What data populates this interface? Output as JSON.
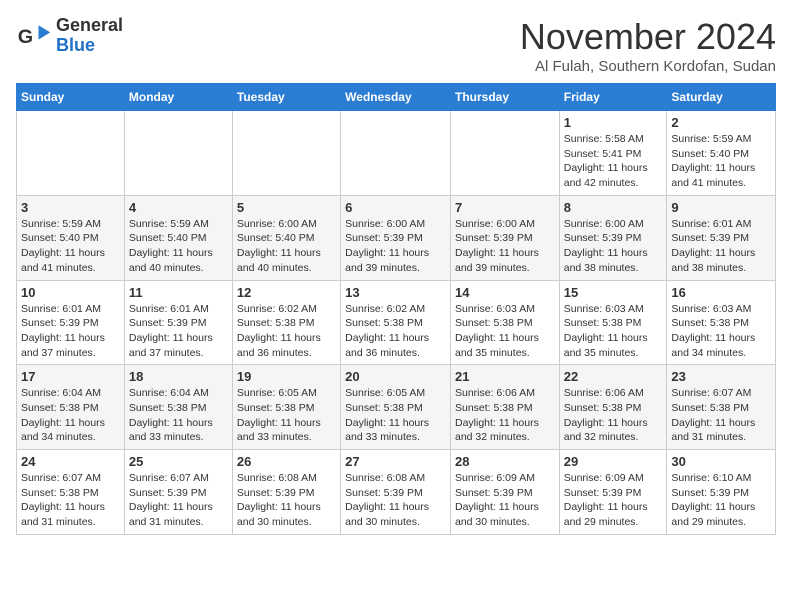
{
  "logo": {
    "text_general": "General",
    "text_blue": "Blue"
  },
  "title": "November 2024",
  "location": "Al Fulah, Southern Kordofan, Sudan",
  "days_of_week": [
    "Sunday",
    "Monday",
    "Tuesday",
    "Wednesday",
    "Thursday",
    "Friday",
    "Saturday"
  ],
  "weeks": [
    [
      {
        "day": "",
        "info": ""
      },
      {
        "day": "",
        "info": ""
      },
      {
        "day": "",
        "info": ""
      },
      {
        "day": "",
        "info": ""
      },
      {
        "day": "",
        "info": ""
      },
      {
        "day": "1",
        "info": "Sunrise: 5:58 AM\nSunset: 5:41 PM\nDaylight: 11 hours\nand 42 minutes."
      },
      {
        "day": "2",
        "info": "Sunrise: 5:59 AM\nSunset: 5:40 PM\nDaylight: 11 hours\nand 41 minutes."
      }
    ],
    [
      {
        "day": "3",
        "info": "Sunrise: 5:59 AM\nSunset: 5:40 PM\nDaylight: 11 hours\nand 41 minutes."
      },
      {
        "day": "4",
        "info": "Sunrise: 5:59 AM\nSunset: 5:40 PM\nDaylight: 11 hours\nand 40 minutes."
      },
      {
        "day": "5",
        "info": "Sunrise: 6:00 AM\nSunset: 5:40 PM\nDaylight: 11 hours\nand 40 minutes."
      },
      {
        "day": "6",
        "info": "Sunrise: 6:00 AM\nSunset: 5:39 PM\nDaylight: 11 hours\nand 39 minutes."
      },
      {
        "day": "7",
        "info": "Sunrise: 6:00 AM\nSunset: 5:39 PM\nDaylight: 11 hours\nand 39 minutes."
      },
      {
        "day": "8",
        "info": "Sunrise: 6:00 AM\nSunset: 5:39 PM\nDaylight: 11 hours\nand 38 minutes."
      },
      {
        "day": "9",
        "info": "Sunrise: 6:01 AM\nSunset: 5:39 PM\nDaylight: 11 hours\nand 38 minutes."
      }
    ],
    [
      {
        "day": "10",
        "info": "Sunrise: 6:01 AM\nSunset: 5:39 PM\nDaylight: 11 hours\nand 37 minutes."
      },
      {
        "day": "11",
        "info": "Sunrise: 6:01 AM\nSunset: 5:39 PM\nDaylight: 11 hours\nand 37 minutes."
      },
      {
        "day": "12",
        "info": "Sunrise: 6:02 AM\nSunset: 5:38 PM\nDaylight: 11 hours\nand 36 minutes."
      },
      {
        "day": "13",
        "info": "Sunrise: 6:02 AM\nSunset: 5:38 PM\nDaylight: 11 hours\nand 36 minutes."
      },
      {
        "day": "14",
        "info": "Sunrise: 6:03 AM\nSunset: 5:38 PM\nDaylight: 11 hours\nand 35 minutes."
      },
      {
        "day": "15",
        "info": "Sunrise: 6:03 AM\nSunset: 5:38 PM\nDaylight: 11 hours\nand 35 minutes."
      },
      {
        "day": "16",
        "info": "Sunrise: 6:03 AM\nSunset: 5:38 PM\nDaylight: 11 hours\nand 34 minutes."
      }
    ],
    [
      {
        "day": "17",
        "info": "Sunrise: 6:04 AM\nSunset: 5:38 PM\nDaylight: 11 hours\nand 34 minutes."
      },
      {
        "day": "18",
        "info": "Sunrise: 6:04 AM\nSunset: 5:38 PM\nDaylight: 11 hours\nand 33 minutes."
      },
      {
        "day": "19",
        "info": "Sunrise: 6:05 AM\nSunset: 5:38 PM\nDaylight: 11 hours\nand 33 minutes."
      },
      {
        "day": "20",
        "info": "Sunrise: 6:05 AM\nSunset: 5:38 PM\nDaylight: 11 hours\nand 33 minutes."
      },
      {
        "day": "21",
        "info": "Sunrise: 6:06 AM\nSunset: 5:38 PM\nDaylight: 11 hours\nand 32 minutes."
      },
      {
        "day": "22",
        "info": "Sunrise: 6:06 AM\nSunset: 5:38 PM\nDaylight: 11 hours\nand 32 minutes."
      },
      {
        "day": "23",
        "info": "Sunrise: 6:07 AM\nSunset: 5:38 PM\nDaylight: 11 hours\nand 31 minutes."
      }
    ],
    [
      {
        "day": "24",
        "info": "Sunrise: 6:07 AM\nSunset: 5:38 PM\nDaylight: 11 hours\nand 31 minutes."
      },
      {
        "day": "25",
        "info": "Sunrise: 6:07 AM\nSunset: 5:39 PM\nDaylight: 11 hours\nand 31 minutes."
      },
      {
        "day": "26",
        "info": "Sunrise: 6:08 AM\nSunset: 5:39 PM\nDaylight: 11 hours\nand 30 minutes."
      },
      {
        "day": "27",
        "info": "Sunrise: 6:08 AM\nSunset: 5:39 PM\nDaylight: 11 hours\nand 30 minutes."
      },
      {
        "day": "28",
        "info": "Sunrise: 6:09 AM\nSunset: 5:39 PM\nDaylight: 11 hours\nand 30 minutes."
      },
      {
        "day": "29",
        "info": "Sunrise: 6:09 AM\nSunset: 5:39 PM\nDaylight: 11 hours\nand 29 minutes."
      },
      {
        "day": "30",
        "info": "Sunrise: 6:10 AM\nSunset: 5:39 PM\nDaylight: 11 hours\nand 29 minutes."
      }
    ]
  ]
}
